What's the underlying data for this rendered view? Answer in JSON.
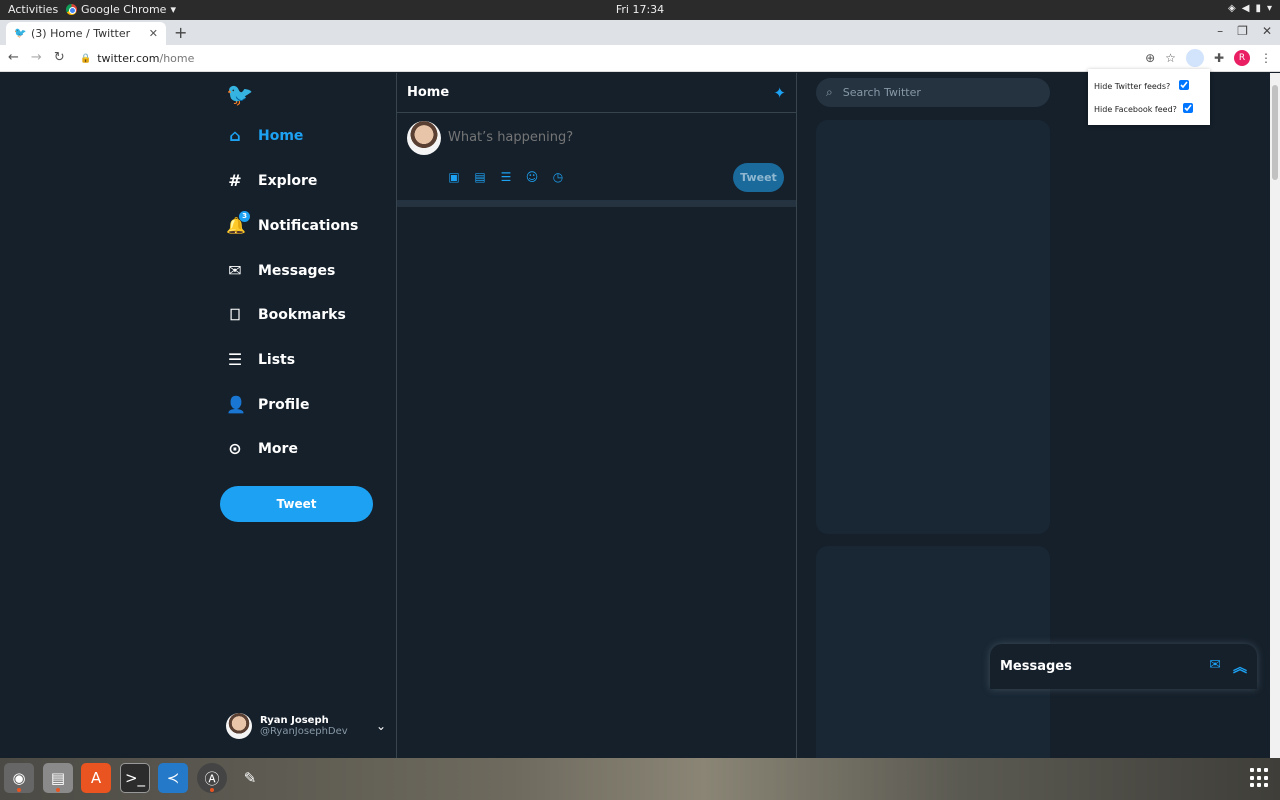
{
  "system": {
    "activities_label": "Activities",
    "app_menu_label": "Google Chrome",
    "clock": "Fri 17:34"
  },
  "browser": {
    "tab_title": "(3) Home / Twitter",
    "url_host": "twitter.com",
    "url_path": "/home",
    "profile_initial": "R"
  },
  "twitter": {
    "nav": [
      {
        "label": "Home",
        "icon": "home-icon",
        "active": true
      },
      {
        "label": "Explore",
        "icon": "hashtag-icon"
      },
      {
        "label": "Notifications",
        "icon": "bell-icon",
        "badge": "3"
      },
      {
        "label": "Messages",
        "icon": "mail-icon"
      },
      {
        "label": "Bookmarks",
        "icon": "bookmark-icon"
      },
      {
        "label": "Lists",
        "icon": "list-icon"
      },
      {
        "label": "Profile",
        "icon": "person-icon"
      },
      {
        "label": "More",
        "icon": "more-icon"
      }
    ],
    "tweet_button_label": "Tweet",
    "account": {
      "name": "Ryan Joseph",
      "handle": "@RyanJosephDev"
    },
    "main_title": "Home",
    "composer_placeholder": "What’s happening?",
    "composer_tweet_label": "Tweet",
    "search_placeholder": "Search Twitter",
    "messages_dock_title": "Messages"
  },
  "extension_popup": {
    "options": [
      {
        "label": "Hide Twitter feeds?",
        "checked": true
      },
      {
        "label": "Hide Facebook feed?",
        "checked": true
      }
    ]
  },
  "colors": {
    "background": "#15202b",
    "accent": "#1da1f2",
    "panel": "#192734"
  }
}
